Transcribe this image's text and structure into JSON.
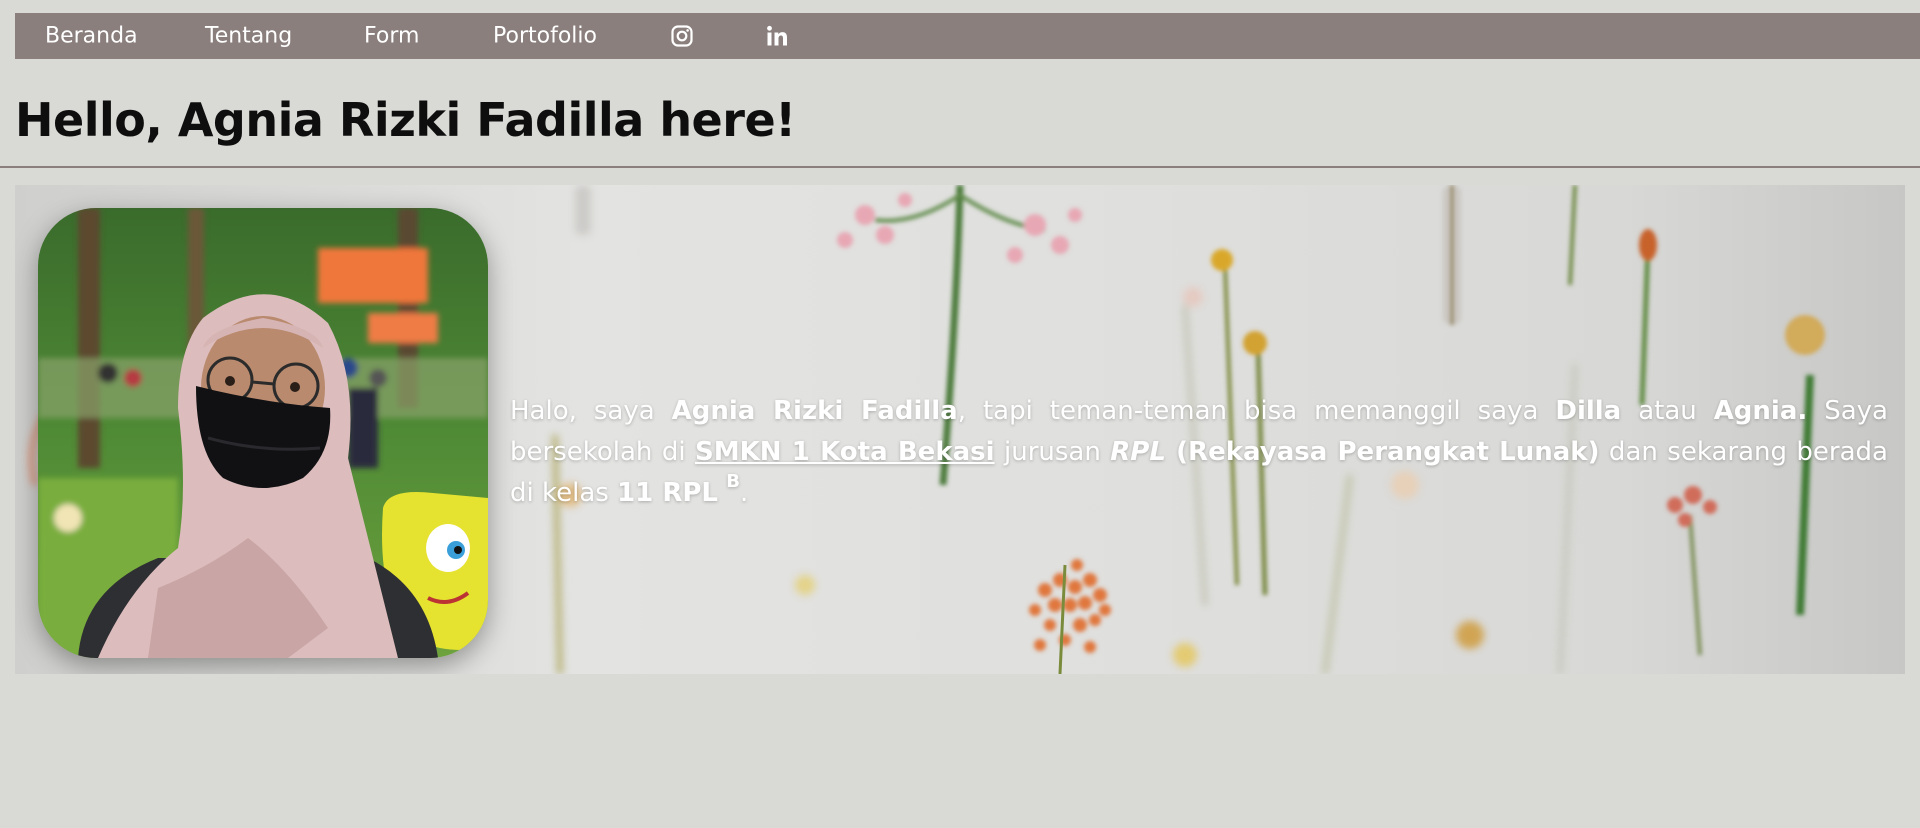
{
  "nav": {
    "items": [
      {
        "label": "Beranda"
      },
      {
        "label": "Tentang"
      },
      {
        "label": "Form"
      },
      {
        "label": "Portofolio"
      }
    ],
    "icons": [
      "instagram-icon",
      "linkedin-icon"
    ],
    "background": "#8a7f7c"
  },
  "header": {
    "title": "Hello, Agnia Rizki Fadilla here!"
  },
  "intro": {
    "t1": "Halo, saya ",
    "name": "Agnia Rizki Fadilla",
    "t2": ", tapi teman-teman bisa memanggil saya ",
    "nick1": "Dilla",
    "t3": " atau ",
    "nick2": "Agnia.",
    "t4": " Saya bersekolah di ",
    "school": "SMKN 1 Kota Bekasi",
    "t5": " jurusan ",
    "major_abbr": "RPL",
    "major_full": " (Rekayasa Perangkat Lunak)",
    "t6": " dan sekarang berada di kelas ",
    "class": "11 RPL",
    "class_sup": "B",
    "t7": "."
  },
  "colors": {
    "page_bg": "#d9dad5",
    "accent": "#8a7f7c",
    "text_on_hero": "#ffffff"
  }
}
